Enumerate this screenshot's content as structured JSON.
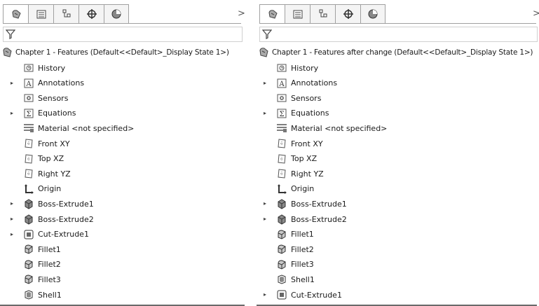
{
  "left": {
    "root_label": "Chapter 1 - Features  (Default<<Default>_Display State 1>)",
    "items": [
      {
        "label": "History",
        "icon": "history-icon",
        "expandable": false
      },
      {
        "label": "Annotations",
        "icon": "annotations-icon",
        "expandable": true
      },
      {
        "label": "Sensors",
        "icon": "sensors-icon",
        "expandable": false
      },
      {
        "label": "Equations",
        "icon": "equations-icon",
        "expandable": true
      },
      {
        "label": "Material <not specified>",
        "icon": "material-icon",
        "expandable": false
      },
      {
        "label": "Front XY",
        "icon": "plane-icon",
        "expandable": false
      },
      {
        "label": "Top XZ",
        "icon": "plane-icon",
        "expandable": false
      },
      {
        "label": "Right YZ",
        "icon": "plane-icon",
        "expandable": false
      },
      {
        "label": "Origin",
        "icon": "origin-icon",
        "expandable": false
      },
      {
        "label": "Boss-Extrude1",
        "icon": "boss-extrude-icon",
        "expandable": true
      },
      {
        "label": "Boss-Extrude2",
        "icon": "boss-extrude-icon",
        "expandable": true
      },
      {
        "label": "Cut-Extrude1",
        "icon": "cut-extrude-icon",
        "expandable": true
      },
      {
        "label": "Fillet1",
        "icon": "fillet-icon",
        "expandable": false
      },
      {
        "label": "Fillet2",
        "icon": "fillet-icon",
        "expandable": false
      },
      {
        "label": "Fillet3",
        "icon": "fillet-icon",
        "expandable": false
      },
      {
        "label": "Shell1",
        "icon": "shell-icon",
        "expandable": false
      }
    ]
  },
  "right": {
    "root_label": "Chapter 1 - Features after change  (Default<<Default>_Display State 1>)",
    "items": [
      {
        "label": "History",
        "icon": "history-icon",
        "expandable": false
      },
      {
        "label": "Annotations",
        "icon": "annotations-icon",
        "expandable": true
      },
      {
        "label": "Sensors",
        "icon": "sensors-icon",
        "expandable": false
      },
      {
        "label": "Equations",
        "icon": "equations-icon",
        "expandable": true
      },
      {
        "label": "Material <not specified>",
        "icon": "material-icon",
        "expandable": false
      },
      {
        "label": "Front XY",
        "icon": "plane-icon",
        "expandable": false
      },
      {
        "label": "Top XZ",
        "icon": "plane-icon",
        "expandable": false
      },
      {
        "label": "Right YZ",
        "icon": "plane-icon",
        "expandable": false
      },
      {
        "label": "Origin",
        "icon": "origin-icon",
        "expandable": false
      },
      {
        "label": "Boss-Extrude1",
        "icon": "boss-extrude-icon",
        "expandable": true
      },
      {
        "label": "Boss-Extrude2",
        "icon": "boss-extrude-icon",
        "expandable": true
      },
      {
        "label": "Fillet1",
        "icon": "fillet-icon",
        "expandable": false
      },
      {
        "label": "Fillet2",
        "icon": "fillet-icon",
        "expandable": false
      },
      {
        "label": "Fillet3",
        "icon": "fillet-icon",
        "expandable": false
      },
      {
        "label": "Shell1",
        "icon": "shell-icon",
        "expandable": false
      },
      {
        "label": "Cut-Extrude1",
        "icon": "cut-extrude-icon",
        "expandable": true
      }
    ]
  },
  "tabs": [
    {
      "icon": "feature-manager-icon"
    },
    {
      "icon": "property-manager-icon"
    },
    {
      "icon": "configuration-manager-icon"
    },
    {
      "icon": "dimxpert-manager-icon"
    },
    {
      "icon": "display-manager-icon"
    }
  ],
  "more_glyph": ">",
  "colors": {
    "border": "#a0a0a0",
    "tab_bg": "#f4f4f4",
    "text": "#1a1a1a",
    "icon_gray": "#555555",
    "icon_accent": "#c8a040"
  }
}
